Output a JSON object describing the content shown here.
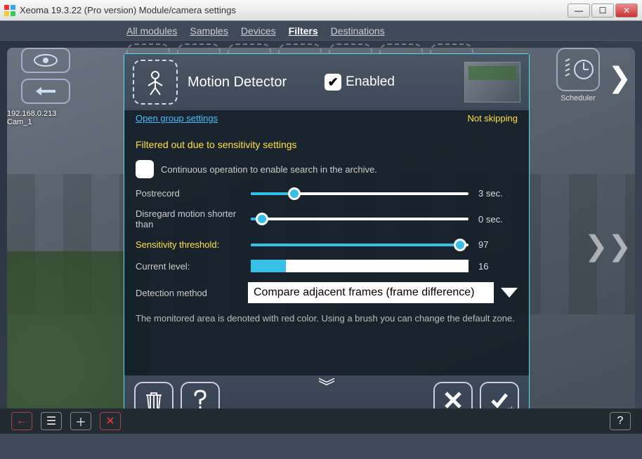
{
  "window": {
    "title": "Xeoma 19.3.22 (Pro version) Module/camera settings"
  },
  "topnav": {
    "items": [
      "All modules",
      "Samples",
      "Devices",
      "Filters",
      "Destinations"
    ],
    "active_index": 3
  },
  "camera": {
    "ip": "192.168.0.213",
    "name": "Cam_1"
  },
  "scheduler": {
    "label": "Scheduler"
  },
  "dialog": {
    "title": "Motion Detector",
    "enabled_label": "Enabled",
    "enabled": true,
    "open_group": "Open group settings",
    "skip_status": "Not skipping",
    "filtered_msg": "Filtered out due to sensitivity settings",
    "continuous_label": "Continuous operation to enable search in the archive.",
    "continuous_checked": false,
    "postrecord": {
      "label": "Postrecord",
      "value": 3,
      "unit": "sec.",
      "pct": 20
    },
    "disregard": {
      "label": "Disregard motion shorter than",
      "value": 0,
      "unit": "sec.",
      "pct": 5
    },
    "sensitivity": {
      "label": "Sensitivity threshold:",
      "value": 97,
      "pct": 96
    },
    "current": {
      "label": "Current level:",
      "value": 16,
      "pct": 16
    },
    "detection": {
      "label": "Detection method",
      "value": "Compare adjacent frames (frame difference)"
    },
    "note": "The monitored area is denoted with red color. Using a brush you can change the default zone.",
    "ok_suffix": "ok"
  }
}
